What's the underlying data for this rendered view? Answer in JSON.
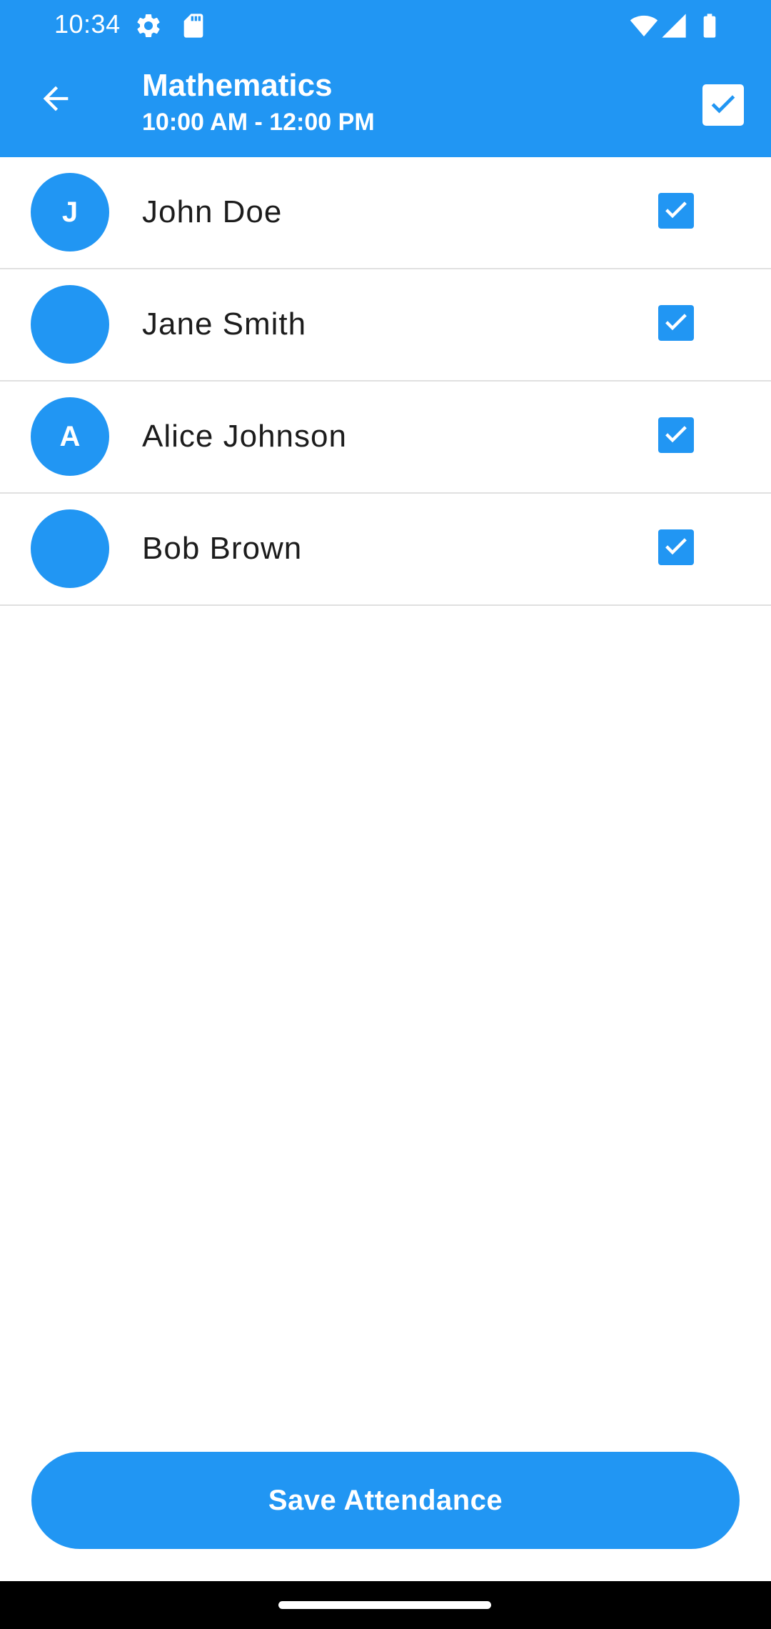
{
  "status_bar": {
    "time": "10:34",
    "icons": [
      "gear-icon",
      "sd-card-icon",
      "wifi-icon",
      "signal-icon",
      "battery-icon"
    ]
  },
  "app_bar": {
    "title": "Mathematics",
    "subtitle": "10:00 AM - 12:00 PM",
    "back_icon": "arrow-left-icon",
    "select_all_checked": true
  },
  "students": [
    {
      "initial": "J",
      "name": "John Doe",
      "checked": true
    },
    {
      "initial": "",
      "name": "Jane Smith",
      "checked": true
    },
    {
      "initial": "A",
      "name": "Alice Johnson",
      "checked": true
    },
    {
      "initial": "",
      "name": "Bob Brown",
      "checked": true
    }
  ],
  "actions": {
    "save_label": "Save Attendance"
  },
  "colors": {
    "primary": "#2196F3",
    "divider": "#e0e0e0",
    "text": "#1c1c1c"
  }
}
